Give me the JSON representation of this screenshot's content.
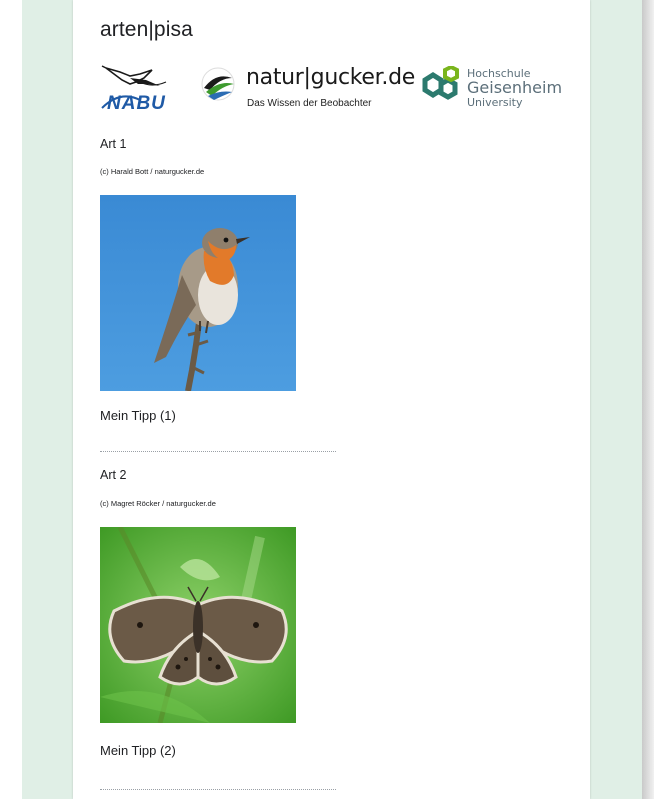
{
  "form": {
    "title": "arten|pisa"
  },
  "logos": {
    "nabu": {
      "text": "NABU",
      "icon": "stork-icon",
      "color": "#1f5aa6"
    },
    "naturgucker": {
      "name": "natur|gucker.de",
      "tagline": "Das Wissen der Beobachter",
      "icon": "naturgucker-swirl-icon"
    },
    "hochschule": {
      "line1": "Hochschule",
      "line2": "Geisenheim",
      "line3": "University",
      "icon": "hexagon-logo-icon",
      "colors": [
        "#7ab51d",
        "#2c7a6e"
      ]
    }
  },
  "questions": [
    {
      "title": "Art 1",
      "credit": "(c) Harald Bott / naturgucker.de",
      "image": "robin-bird-photo",
      "answer_label": "Mein Tipp (1)",
      "answer_value": ""
    },
    {
      "title": "Art 2",
      "credit": "(c) Magret Röcker / naturgucker.de",
      "image": "ringlet-butterfly-photo",
      "answer_label": "Mein Tipp (2)",
      "answer_value": ""
    }
  ],
  "colors": {
    "page_background": "#e0efe6",
    "card": "#ffffff",
    "sky_blue": "#3b8fd6",
    "leaf_green": "#5cb83a"
  }
}
